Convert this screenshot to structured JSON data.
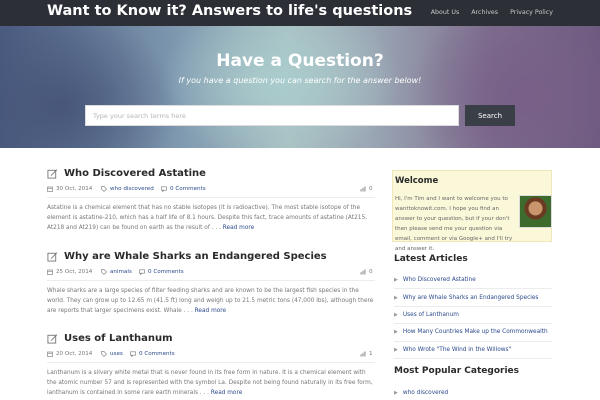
{
  "header": {
    "site_title": "Want to Know it? Answers to life's questions",
    "nav": [
      "About Us",
      "Archives",
      "Privacy Policy"
    ]
  },
  "hero": {
    "title": "Have a Question?",
    "subtitle": "If you have a question you can search for the answer below!",
    "search_placeholder": "Type your search terms here",
    "search_value": "",
    "search_button": "Search"
  },
  "articles": [
    {
      "title": "Who Discovered Astatine",
      "date": "30 Oct, 2014",
      "category": "who discovered",
      "comments": "0 Comments",
      "likes": "0",
      "excerpt": "Astatine is a chemical element that has no stable isotopes (it is radioactive). The most stable isotope of the element is astatine-210, which has a half life of 8.1 hours. Despite this fact, trace amounts of astatine (At215, At218 and At219) can be found on earth as the result of . . .",
      "more": "Read more"
    },
    {
      "title": "Why are Whale Sharks an Endangered Species",
      "date": "25 Oct, 2014",
      "category": "animals",
      "comments": "0 Comments",
      "likes": "0",
      "excerpt": "Whale sharks are a large species of filter feeding sharks and are known to be the largest fish species in the world. They can grow up to 12.65 m (41.5 ft) long and weigh up to 21.5 metric tons (47,000 lbs), although there are reports that larger specimens exist. Whale . . .",
      "more": "Read more"
    },
    {
      "title": "Uses of Lanthanum",
      "date": "20 Oct, 2014",
      "category": "uses",
      "comments": "0 Comments",
      "likes": "1",
      "excerpt": "Lanthanum is a silvery white metal that is never found in its free form in nature. It is a chemical element with the atomic number 57 and is represented with the symbol La. Despite not being found naturally in its free form, lanthanum is contained in some rare earth minerals . . .",
      "more": "Read more"
    }
  ],
  "sidebar": {
    "welcome_title": "Welcome",
    "welcome_text": "Hi, I'm Tim and I want to welcome you to wanttoknowit.com. I hope you find an answer to your question, but if your don't then please send me your question via email, comment or via Google+ and I'll try and answer it.",
    "latest_title": "Latest Articles",
    "latest": [
      "Who Discovered Astatine",
      "Why are Whale Sharks an Endangered Species",
      "Uses of Lanthanum",
      "How Many Countries Make up the Commonwealth",
      "Who Wrote \"The Wind in the Willows\""
    ],
    "popular_title": "Most Popular Categories",
    "popular": [
      "who discovered"
    ]
  },
  "colors": {
    "topbar": "#2c2f36",
    "link": "#2b4a8b",
    "welcome_bg": "#fbf7d9",
    "search_button": "#3a3f47"
  }
}
